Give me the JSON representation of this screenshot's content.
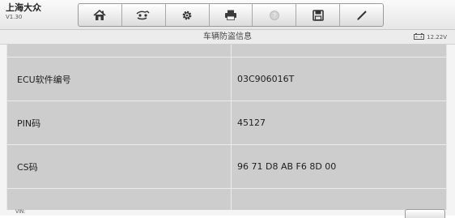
{
  "header": {
    "title": "上海大众",
    "version": "V1.30"
  },
  "toolbar": {
    "buttons": [
      {
        "icon": "home-icon"
      },
      {
        "icon": "vehicle-swap-icon"
      },
      {
        "icon": "gear-icon"
      },
      {
        "icon": "print-icon"
      },
      {
        "icon": "help-icon",
        "disabled": true
      },
      {
        "icon": "save-icon"
      },
      {
        "icon": "pen-icon"
      }
    ]
  },
  "page": {
    "title": "车辆防盗信息"
  },
  "status": {
    "battery_voltage": "12.22V",
    "battery_icon": "battery-icon"
  },
  "table": {
    "rows": [
      {
        "label": "",
        "value": ""
      },
      {
        "label": "ECU软件编号",
        "value": "03C906016T"
      },
      {
        "label": "PIN码",
        "value": "45127"
      },
      {
        "label": "CS码",
        "value": "96 71 D8 AB F6 8D 00"
      },
      {
        "label": "",
        "value": ""
      }
    ]
  },
  "footer": {
    "vin_label": "VIN:"
  },
  "colors": {
    "table_background": "#cdcdcd",
    "row_separator": "#ececec",
    "toolbar_border": "#9a9a9a"
  }
}
